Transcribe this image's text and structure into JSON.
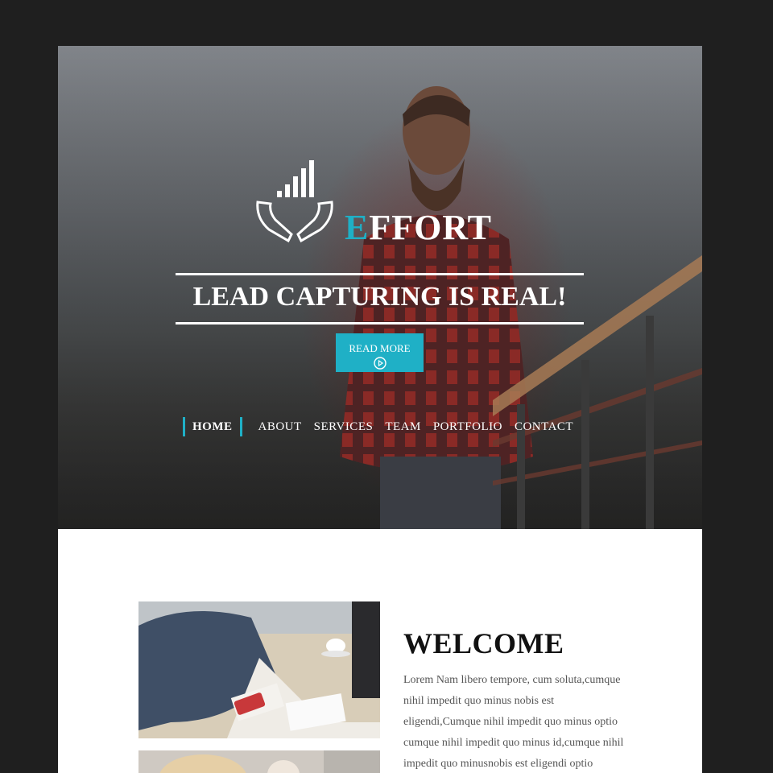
{
  "colors": {
    "background": "#1f1f1f",
    "accent": "#1fb0c6",
    "text_dark": "#111111",
    "text_body": "#555555"
  },
  "logo": {
    "first_letter": "E",
    "rest": "FFORT",
    "icon": "hands-with-bar-chart-icon"
  },
  "hero": {
    "tagline": "LEAD CAPTURING IS REAL!",
    "button_label": "READ MORE",
    "button_icon": "play-circle-icon"
  },
  "nav": {
    "items": [
      {
        "label": "HOME"
      },
      {
        "label": "ABOUT"
      },
      {
        "label": "SERVICES"
      },
      {
        "label": "TEAM"
      },
      {
        "label": "PORTFOLIO"
      },
      {
        "label": "CONTACT"
      }
    ]
  },
  "welcome": {
    "title": "WELCOME",
    "body": "Lorem Nam libero tempore, cum soluta,cumque nihil impedit quo minus nobis est eligendi,Cumque nihil impedit quo minus optio cumque nihil impedit quo minus id,cumque nihil impedit quo minusnobis est eligendi optio"
  }
}
